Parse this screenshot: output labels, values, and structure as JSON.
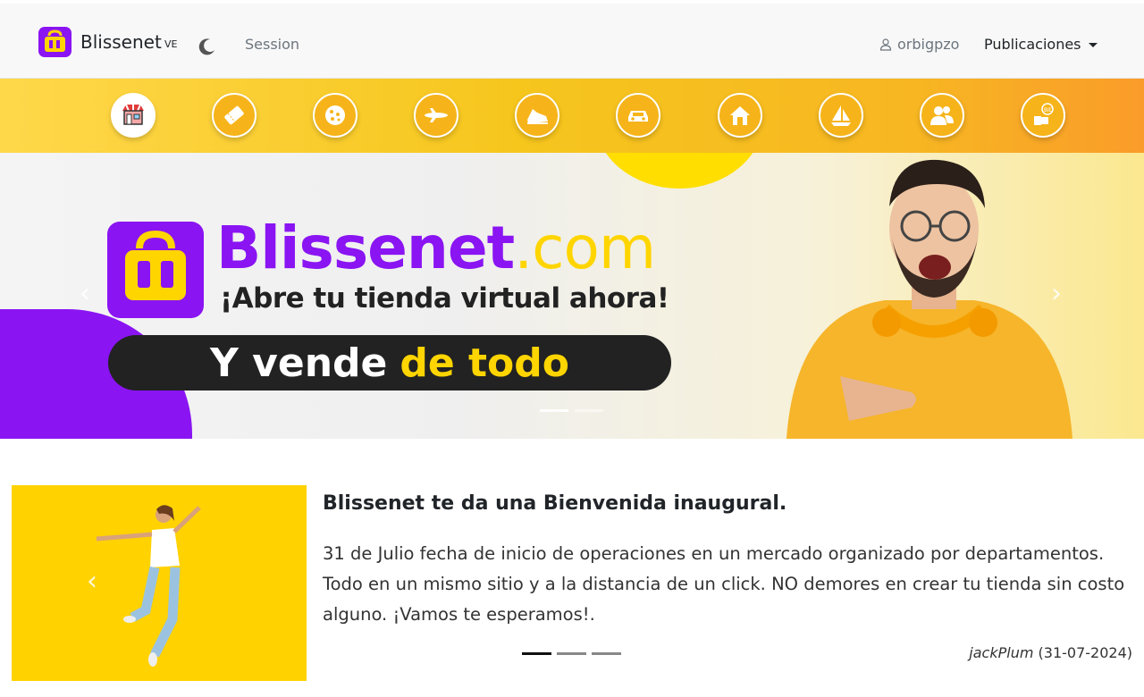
{
  "navbar": {
    "brand_name": "Blissenet",
    "country": "VE",
    "session_label": "Session",
    "username": "orbigpzo",
    "publicaciones_label": "Publicaciones"
  },
  "categories": [
    {
      "icon": "store-icon"
    },
    {
      "icon": "ticket-icon"
    },
    {
      "icon": "cookie-icon"
    },
    {
      "icon": "airplane-icon"
    },
    {
      "icon": "sneaker-icon"
    },
    {
      "icon": "car-icon"
    },
    {
      "icon": "house-icon"
    },
    {
      "icon": "sailboat-icon"
    },
    {
      "icon": "people-icon"
    },
    {
      "icon": "bid-hand-icon"
    }
  ],
  "banner": {
    "brand_name": "Blissenet",
    "brand_domain": ".com",
    "tagline": "¡Abre tu tienda virtual ahora!",
    "pill_white": "Y vende",
    "pill_yellow": "de todo",
    "prev_arrow": "‹",
    "next_arrow": "›",
    "slides": 2,
    "active_slide": 1
  },
  "news": {
    "title": "Blissenet te da una Bienvenida inaugural.",
    "body": "31 de Julio fecha de inicio de operaciones en un mercado organizado por departamentos. Todo en un mismo sitio y a la distancia de un click. NO demores en crear tu tienda sin costo alguno. ¡Vamos te esperamos!.",
    "author": "jackPlum",
    "date": "(31-07-2024)",
    "prev_arrow": "‹",
    "slides": 3,
    "active_slide": 1
  },
  "colors": {
    "brand_purple": "#8a14f2",
    "brand_yellow": "#ffd500"
  }
}
